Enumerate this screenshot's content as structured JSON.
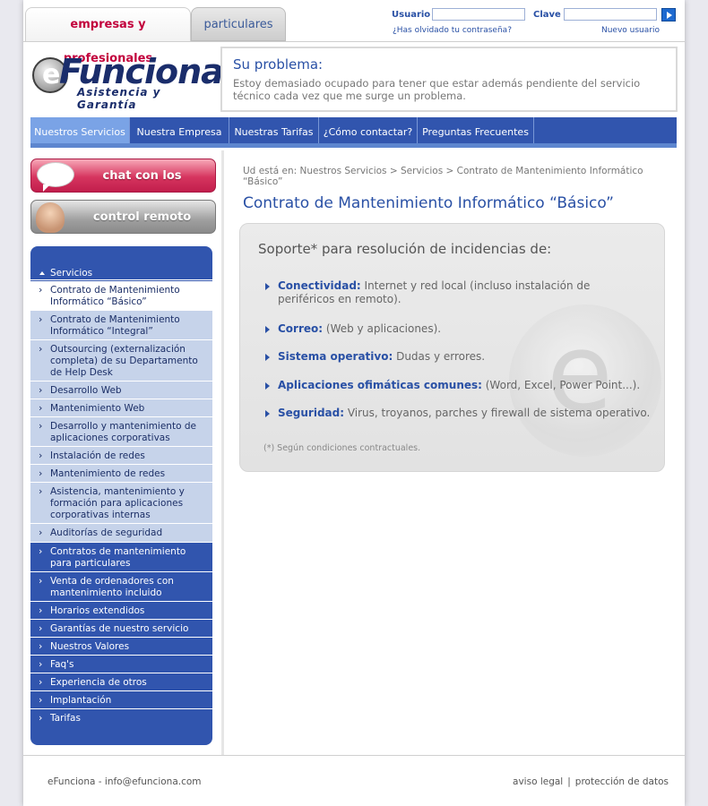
{
  "top_tabs": {
    "empresas": "empresas y profesionales",
    "particulares": "particulares"
  },
  "login": {
    "user_label": "Usuario",
    "user_value": "",
    "pass_label": "Clave",
    "pass_value": "",
    "forgot": "¿Has olvidado tu contraseña?",
    "new_user": "Nuevo usuario"
  },
  "logo": {
    "word": "eFunciona",
    "e": "e",
    "word_rest": "Funciona",
    "subtitle": "Asistencia y Garantía"
  },
  "problem": {
    "title": "Su problema:",
    "text": "Estoy demasiado ocupado para tener que estar además pendiente del servicio técnico cada vez que me surge un problema."
  },
  "nav": [
    "Nuestros Servicios",
    "Nuestra Empresa",
    "Nuestras Tarifas",
    "¿Cómo contactar?",
    "Preguntas Frecuentes"
  ],
  "side_buttons": {
    "chat": "chat con los técnicos",
    "remote": "control remoto"
  },
  "sidemenu": {
    "heading": "Servicios",
    "items": [
      "Contrato de Mantenimiento Informático “Básico”",
      "Contrato de Mantenimiento Informático “Integral”",
      "Outsourcing (externalización completa) de su Departamento de Help Desk",
      "Desarrollo Web",
      "Mantenimiento Web",
      "Desarrollo y mantenimiento de aplicaciones corporativas",
      "Instalación de redes",
      "Mantenimiento de redes",
      "Asistencia, mantenimiento y formación para aplicaciones corporativas internas",
      "Auditorías de seguridad",
      "Contratos de mantenimiento para particulares",
      "Venta de ordenadores con mantenimiento incluido",
      "Horarios extendidos",
      "Garantías de nuestro servicio",
      "Nuestros Valores",
      "Faq's",
      "Experiencia de otros",
      "Implantación",
      "Tarifas"
    ]
  },
  "breadcrumb": "Ud está en: Nuestros Servicios > Servicios > Contrato de Mantenimiento Informático “Básico”",
  "content": {
    "title": "Contrato de Mantenimiento Informático “Básico”",
    "panel_heading": "Soporte* para resolución de incidencias de:",
    "items": [
      {
        "label": "Conectividad:",
        "text": " Internet y red local (incluso instalación de periféricos en remoto)."
      },
      {
        "label": "Correo:",
        "text": " (Web y aplicaciones)."
      },
      {
        "label": "Sistema operativo:",
        "text": " Dudas y errores."
      },
      {
        "label": "Aplicaciones ofimáticas comunes:",
        "text": " (Word, Excel, Power Point...)."
      },
      {
        "label": "Seguridad:",
        "text": " Virus, troyanos, parches y firewall de sistema operativo."
      }
    ],
    "note": "(*) Según condiciones contractuales."
  },
  "footer": {
    "left": "eFunciona - info@efunciona.com",
    "legal": "aviso legal",
    "sep": "|",
    "privacy": "protección de datos"
  },
  "colors": {
    "brand_blue": "#3155ae",
    "accent_red": "#c2003c",
    "link_blue": "#2950a5"
  }
}
